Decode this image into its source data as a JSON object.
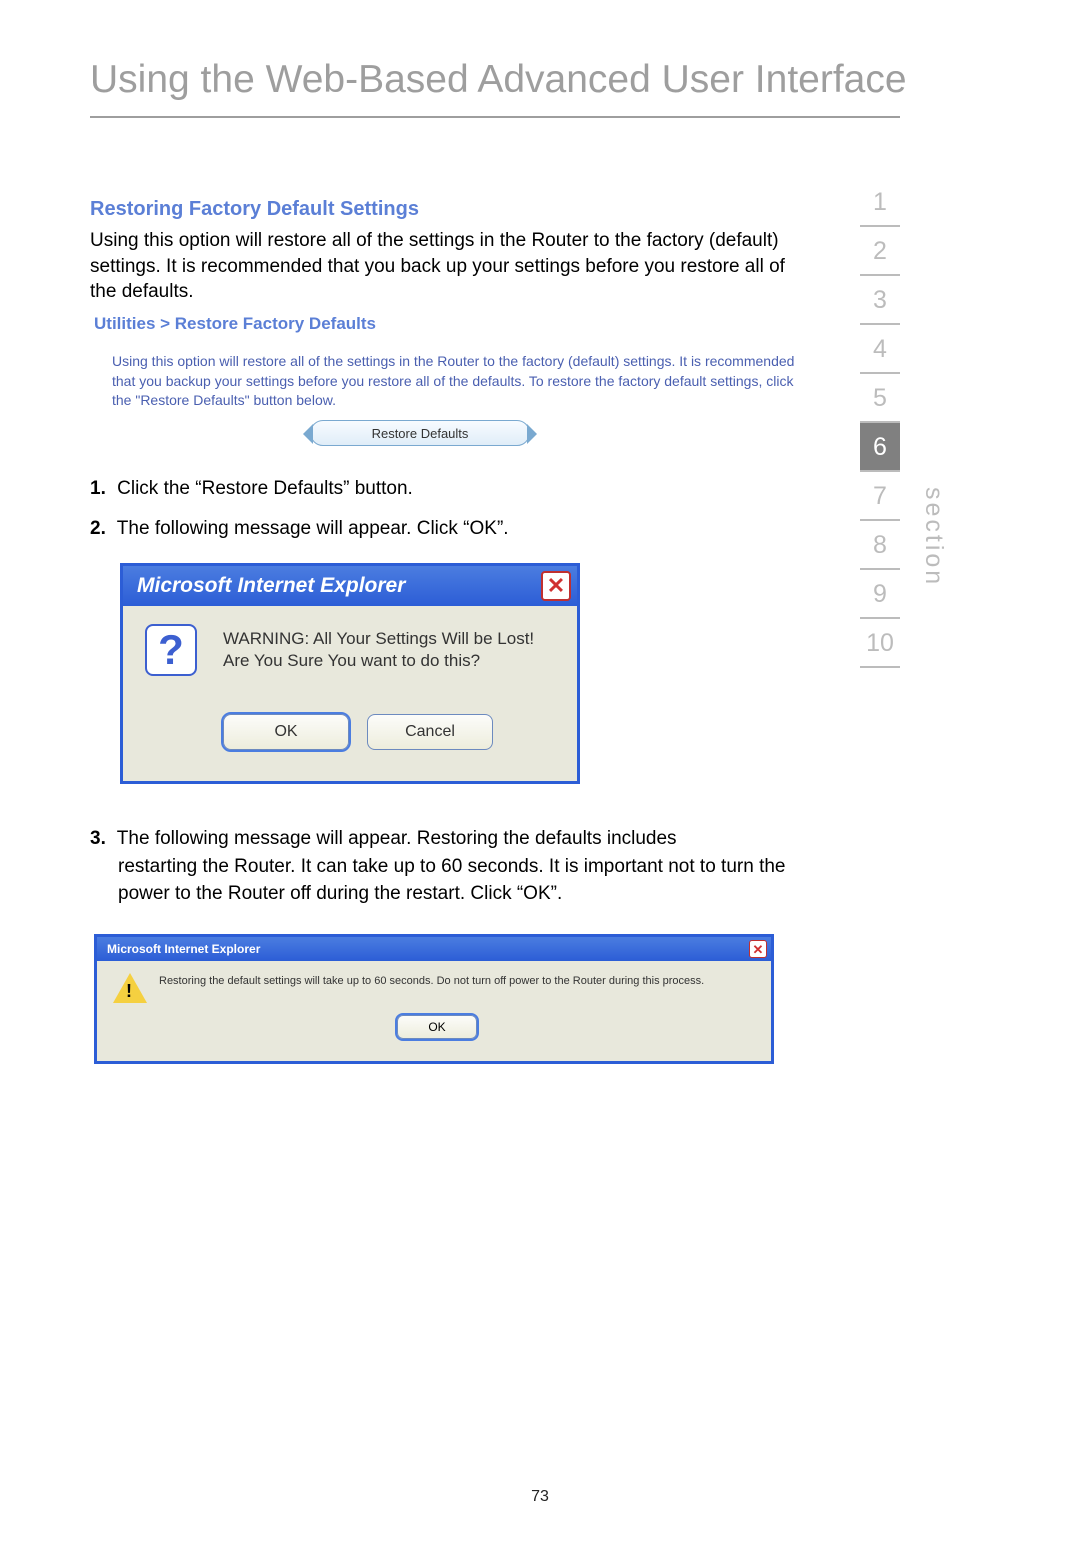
{
  "page_title": "Using the Web-Based Advanced User Interface",
  "section_heading": "Restoring Factory Default Settings",
  "intro_text": "Using this option will restore all of the settings in the Router to the factory (default) settings. It is recommended that you back up your settings before you restore all of the defaults.",
  "breadcrumb": "Utilities > Restore Factory Defaults",
  "router_help": "Using this option will restore all of the settings in the Router to the factory (default) settings. It is recommended that you backup your settings before you restore all of the defaults. To restore the factory default settings, click the \"Restore Defaults\" button below.",
  "restore_button": "Restore Defaults",
  "steps": {
    "s1_num": "1.",
    "s1_text": "Click the “Restore Defaults” button.",
    "s2_num": "2.",
    "s2_text": "The following message will appear. Click “OK”.",
    "s3_num": "3.",
    "s3_text_a": "The following message will appear. Restoring the defaults includes",
    "s3_text_b": "restarting the Router. It can take up to 60 seconds. It is important not to turn the power to the Router off during the restart. Click “OK”."
  },
  "dialog1": {
    "title": "Microsoft Internet Explorer",
    "line1": "WARNING: All Your Settings Will be Lost!",
    "line2": "Are You Sure You want to do this?",
    "ok": "OK",
    "cancel": "Cancel"
  },
  "dialog2": {
    "title": "Microsoft Internet Explorer",
    "text": "Restoring the default settings will take up to 60 seconds. Do not turn off power to the Router during this process.",
    "ok": "OK"
  },
  "nav": [
    "1",
    "2",
    "3",
    "4",
    "5",
    "6",
    "7",
    "8",
    "9",
    "10"
  ],
  "nav_active_index": 5,
  "section_label": "section",
  "page_number": "73"
}
